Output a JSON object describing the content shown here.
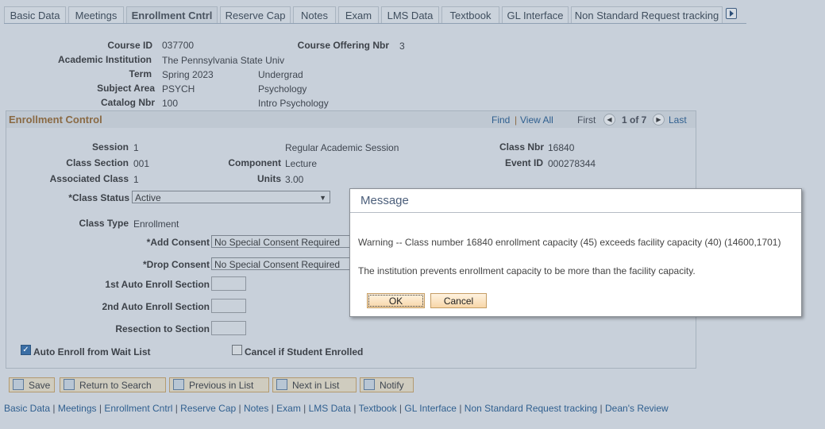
{
  "tabs": [
    "Basic Data",
    "Meetings",
    "Enrollment Cntrl",
    "Reserve Cap",
    "Notes",
    "Exam",
    "LMS Data",
    "Textbook",
    "GL Interface",
    "Non Standard Request tracking"
  ],
  "header": {
    "course_id_label": "Course ID",
    "course_id": "037700",
    "offering_label": "Course Offering Nbr",
    "offering": "3",
    "institution_label": "Academic Institution",
    "institution": "The Pennsylvania State Univ",
    "term_label": "Term",
    "term": "Spring 2023",
    "career": "Undergrad",
    "subject_label": "Subject Area",
    "subject": "PSYCH",
    "subject_desc": "Psychology",
    "catalog_label": "Catalog Nbr",
    "catalog": "100",
    "catalog_desc": "Intro Psychology"
  },
  "enrollment": {
    "title": "Enrollment Control",
    "find": "Find",
    "view_all": "View All",
    "first": "First",
    "count": "1 of 7",
    "last": "Last",
    "session_label": "Session",
    "session": "1",
    "session_desc": "Regular Academic Session",
    "class_nbr_label": "Class Nbr",
    "class_nbr": "16840",
    "section_label": "Class Section",
    "section": "001",
    "component_label": "Component",
    "component": "Lecture",
    "event_label": "Event ID",
    "event": "000278344",
    "assoc_label": "Associated Class",
    "assoc": "1",
    "units_label": "Units",
    "units": "3.00",
    "status_label": "*Class Status",
    "status": "Active",
    "type_label": "Class Type",
    "type": "Enrollment",
    "add_label": "*Add Consent",
    "add": "No Special Consent Required",
    "drop_label": "*Drop Consent",
    "drop": "No Special Consent Required",
    "auto1_label": "1st Auto Enroll Section",
    "auto2_label": "2nd Auto Enroll Section",
    "resection_label": "Resection to Section",
    "auto_wait_label": "Auto Enroll from Wait List",
    "auto_wait_checked": true,
    "cancel_label": "Cancel if Student Enrolled",
    "cancel_checked": false
  },
  "buttons": [
    "Save",
    "Return to Search",
    "Previous in List",
    "Next in List",
    "Notify"
  ],
  "footer_links": [
    "Basic Data",
    "Meetings",
    "Enrollment Cntrl",
    "Reserve Cap",
    "Notes",
    "Exam",
    "LMS Data",
    "Textbook",
    "GL Interface",
    "Non Standard Request tracking",
    "Dean's Review"
  ],
  "dialog": {
    "title": "Message",
    "warning": "Warning -- Class number 16840 enrollment capacity (45) exceeds facility capacity (40) (14600,1701)",
    "info": "The institution prevents enrollment capacity to be more than the facility capacity.",
    "ok": "OK",
    "cancel": "Cancel"
  }
}
